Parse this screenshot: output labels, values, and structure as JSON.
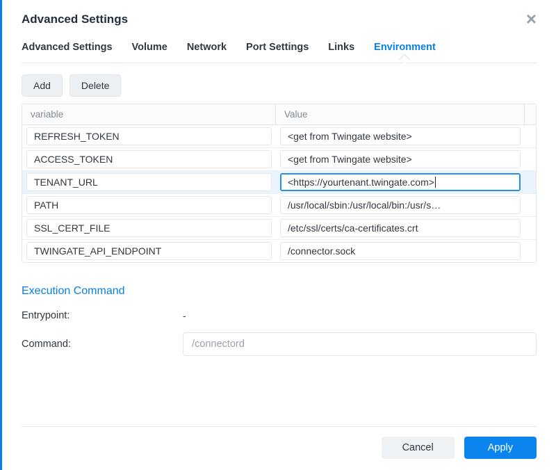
{
  "header": {
    "title": "Advanced Settings"
  },
  "tabs": [
    {
      "label": "Advanced Settings",
      "active": false
    },
    {
      "label": "Volume",
      "active": false
    },
    {
      "label": "Network",
      "active": false
    },
    {
      "label": "Port Settings",
      "active": false
    },
    {
      "label": "Links",
      "active": false
    },
    {
      "label": "Environment",
      "active": true
    }
  ],
  "toolbar": {
    "add_label": "Add",
    "delete_label": "Delete"
  },
  "env_table": {
    "headers": {
      "variable": "variable",
      "value": "Value"
    },
    "rows": [
      {
        "variable": "REFRESH_TOKEN",
        "value": "<get from Twingate website>",
        "selected": false
      },
      {
        "variable": "ACCESS_TOKEN",
        "value": "<get from Twingate website>",
        "selected": false
      },
      {
        "variable": "TENANT_URL",
        "value": "<https://yourtenant.twingate.com>",
        "selected": true
      },
      {
        "variable": "PATH",
        "value": "/usr/local/sbin:/usr/local/bin:/usr/s…",
        "selected": false
      },
      {
        "variable": "SSL_CERT_FILE",
        "value": "/etc/ssl/certs/ca-certificates.crt",
        "selected": false
      },
      {
        "variable": "TWINGATE_API_ENDPOINT",
        "value": "/connector.sock",
        "selected": false
      }
    ]
  },
  "execution": {
    "section_title": "Execution Command",
    "entrypoint_label": "Entrypoint:",
    "entrypoint_value": "-",
    "command_label": "Command:",
    "command_value": "/connectord"
  },
  "footer": {
    "cancel_label": "Cancel",
    "apply_label": "Apply"
  }
}
